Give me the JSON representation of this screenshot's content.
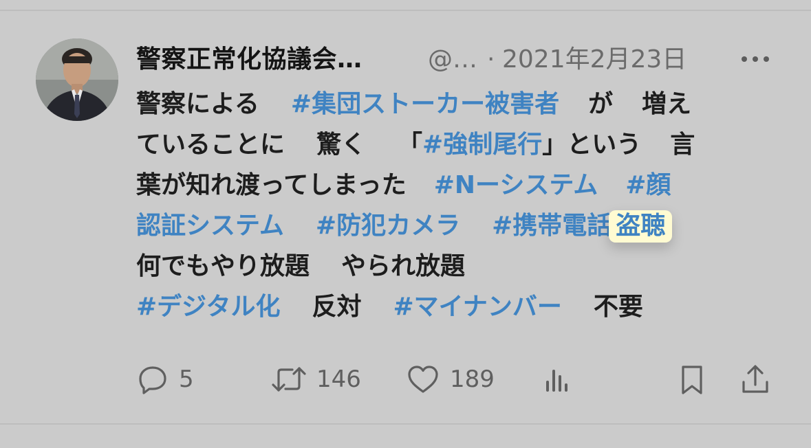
{
  "tweet": {
    "author": {
      "display_name": "警察正常化協議会…",
      "handle": "@…",
      "separator": "·",
      "date": "2021年2月23日"
    },
    "lines": [
      [
        {
          "t": "警察による",
          "kind": "text"
        },
        {
          "t": "#集団ストーカー被害者",
          "kind": "tag"
        },
        {
          "t": "が",
          "kind": "text"
        },
        {
          "t": "増え",
          "kind": "text"
        }
      ],
      [
        {
          "t": "ていることに",
          "kind": "text"
        },
        {
          "t": "驚く",
          "kind": "text"
        },
        {
          "t": "「",
          "kind": "text"
        },
        {
          "t": "#強制尾行",
          "kind": "tag"
        },
        {
          "t": "」という",
          "kind": "text"
        },
        {
          "t": "言",
          "kind": "text"
        }
      ],
      [
        {
          "t": "葉が知れ渡ってしまった",
          "kind": "text"
        },
        {
          "t": "#Nーシステム",
          "kind": "tag"
        },
        {
          "t": "#顔",
          "kind": "tag"
        }
      ],
      [
        {
          "t": "認証システム",
          "kind": "tag"
        },
        {
          "t": "#防犯カメラ",
          "kind": "tag"
        },
        {
          "t": "#携帯電話",
          "kind": "tag"
        },
        {
          "t": "盗聴",
          "kind": "highlight"
        }
      ],
      [
        {
          "t": "何でもやり放題",
          "kind": "text"
        },
        {
          "t": "やられ放題",
          "kind": "text"
        }
      ],
      [
        {
          "t": "#デジタル化",
          "kind": "tag"
        },
        {
          "t": "反対",
          "kind": "text"
        },
        {
          "t": "#マイナンバー",
          "kind": "tag"
        },
        {
          "t": "不要",
          "kind": "text"
        }
      ]
    ]
  },
  "actions": {
    "replies": "5",
    "retweets": "146",
    "likes": "189"
  },
  "icons": {
    "reply": "reply-icon",
    "retweet": "retweet-icon",
    "like": "heart-icon",
    "views": "analytics-icon",
    "bookmark": "bookmark-icon",
    "share": "share-icon",
    "more": "more-dots-icon"
  },
  "colors": {
    "background": "#cbcbcb",
    "hashtag": "#3f83c2",
    "highlight": "#fffbd2",
    "text": "#1d1d1d",
    "muted": "#6b6b6b"
  }
}
